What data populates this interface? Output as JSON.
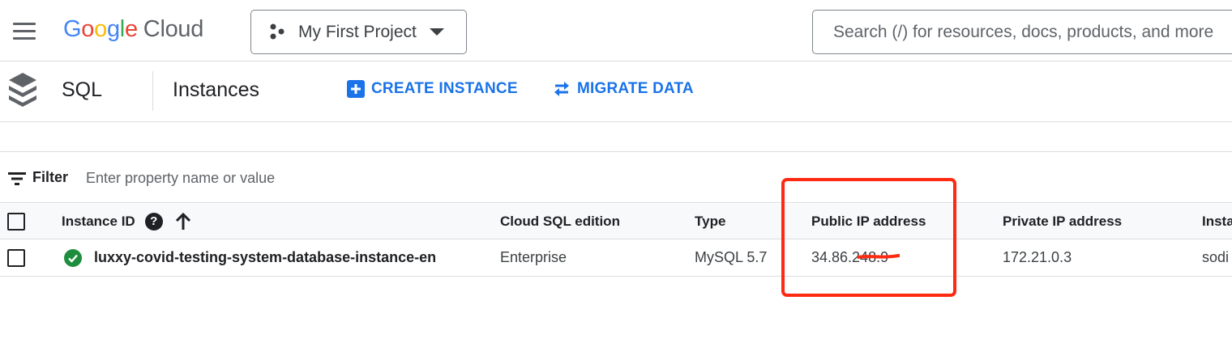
{
  "header": {
    "logo": {
      "google_letters": [
        "G",
        "o",
        "o",
        "g",
        "l",
        "e"
      ],
      "google_colors": [
        "#4285f4",
        "#ea4335",
        "#fbbc04",
        "#4285f4",
        "#34a853",
        "#ea4335"
      ],
      "cloud": "Cloud"
    },
    "project": "My First Project",
    "search_placeholder": "Search (/) for resources, docs, products, and more"
  },
  "subheader": {
    "product": "SQL",
    "title": "Instances",
    "create_label": "CREATE INSTANCE",
    "migrate_label": "MIGRATE DATA"
  },
  "filter": {
    "label": "Filter",
    "placeholder": "Enter property name or value"
  },
  "table": {
    "columns": {
      "instance_id": "Instance ID",
      "edition": "Cloud SQL edition",
      "type": "Type",
      "public_ip": "Public IP address",
      "private_ip": "Private IP address",
      "next": "Insta"
    },
    "rows": [
      {
        "status": "running",
        "instance_id": "luxxy-covid-testing-system-database-instance-en",
        "edition": "Enterprise",
        "type": "MySQL 5.7",
        "public_ip": "34.86.",
        "public_ip_redacted": "248.9",
        "private_ip": "172.21.0.3",
        "next": "sodi"
      }
    ]
  },
  "colors": {
    "accent": "#1a73e8",
    "success": "#1e8e3e",
    "annotation": "#ff2a12"
  },
  "icons": [
    "menu-icon",
    "project-icon",
    "caret-down-icon",
    "sql-stack-icon",
    "plus-box-icon",
    "swap-arrows-icon",
    "filter-icon",
    "help-icon",
    "arrow-up-icon",
    "check-circle-icon"
  ]
}
